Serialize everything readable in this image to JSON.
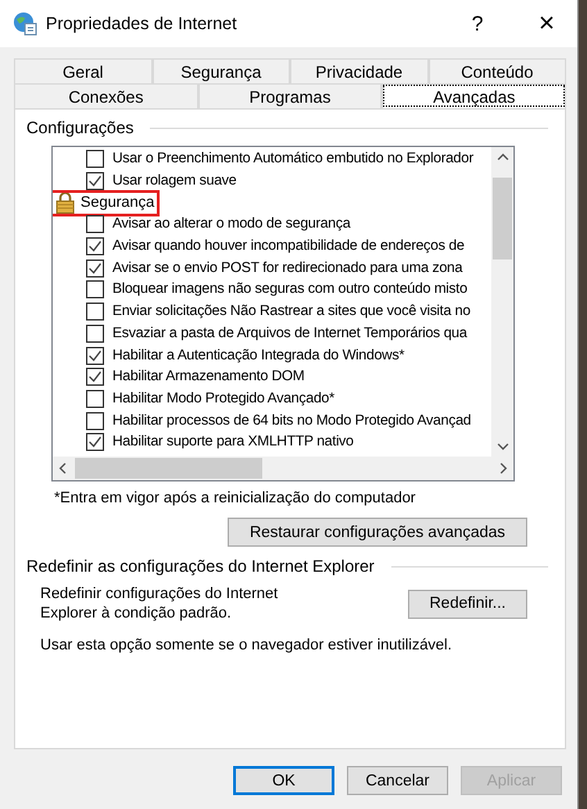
{
  "window": {
    "title": "Propriedades de Internet",
    "help": "?",
    "close": "×"
  },
  "tab_rows": [
    [
      {
        "label": "Geral",
        "selected": false
      },
      {
        "label": "Segurança",
        "selected": false
      },
      {
        "label": "Privacidade",
        "selected": false
      },
      {
        "label": "Conteúdo",
        "selected": false
      }
    ],
    [
      {
        "label": "Conexões",
        "selected": false
      },
      {
        "label": "Programas",
        "selected": false
      },
      {
        "label": "Avançadas",
        "selected": true
      }
    ]
  ],
  "settings": {
    "title": "Configurações",
    "items": [
      {
        "kind": "checkbox",
        "label": "Usar o Preenchimento Automático embutido no Explorador",
        "checked": false
      },
      {
        "kind": "checkbox",
        "label": "Usar rolagem suave",
        "checked": true
      },
      {
        "kind": "category",
        "label": "Segurança",
        "highlighted": true
      },
      {
        "kind": "checkbox",
        "label": "Avisar ao alterar o modo de segurança",
        "checked": false
      },
      {
        "kind": "checkbox",
        "label": "Avisar quando houver incompatibilidade de endereços de",
        "checked": true
      },
      {
        "kind": "checkbox",
        "label": "Avisar se o envio POST for redirecionado para uma zona",
        "checked": true
      },
      {
        "kind": "checkbox",
        "label": "Bloquear imagens não seguras com outro conteúdo misto",
        "checked": false
      },
      {
        "kind": "checkbox",
        "label": "Enviar solicitações Não Rastrear a sites que você visita no",
        "checked": false
      },
      {
        "kind": "checkbox",
        "label": "Esvaziar a pasta de Arquivos de Internet Temporários qua",
        "checked": false
      },
      {
        "kind": "checkbox",
        "label": "Habilitar a Autenticação Integrada do Windows*",
        "checked": true
      },
      {
        "kind": "checkbox",
        "label": "Habilitar Armazenamento DOM",
        "checked": true
      },
      {
        "kind": "checkbox",
        "label": "Habilitar Modo Protegido Avançado*",
        "checked": false
      },
      {
        "kind": "checkbox",
        "label": "Habilitar processos de 64 bits no Modo Protegido Avançad",
        "checked": false
      },
      {
        "kind": "checkbox",
        "label": "Habilitar suporte para XMLHTTP nativo",
        "checked": true
      }
    ],
    "note": "*Entra em vigor após a reinicialização do computador",
    "restore_button": "Restaurar configurações avançadas"
  },
  "reset": {
    "title": "Redefinir as configurações do Internet Explorer",
    "description": "Redefinir configurações do Internet Explorer à condição padrão.",
    "button": "Redefinir...",
    "warning": "Usar esta opção somente se o navegador estiver inutilizável."
  },
  "buttons": [
    {
      "label": "OK",
      "default": true,
      "disabled": false
    },
    {
      "label": "Cancelar",
      "default": false,
      "disabled": false
    },
    {
      "label": "Aplicar",
      "default": false,
      "disabled": true
    }
  ]
}
